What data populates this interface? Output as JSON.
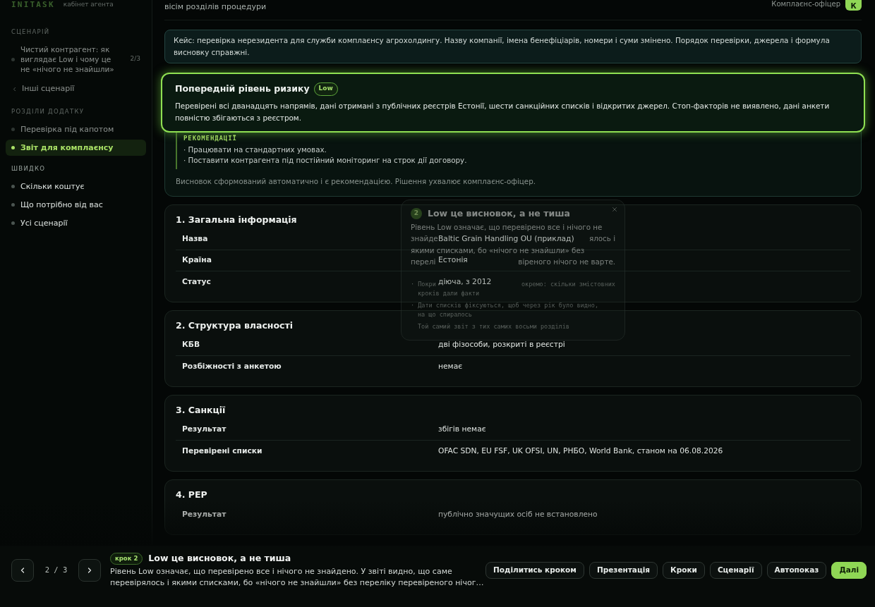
{
  "sidebar": {
    "brand": {
      "name": "INITASK",
      "note": "кабінет агента",
      "dimmed": true
    },
    "groups": [
      {
        "label": "СЦЕНАРІЙ",
        "dimmed": true,
        "items": [
          {
            "kind": "scenario",
            "label": "Чистий контрагент: як виглядає Low і чому це не «нічого не знайшли»",
            "count": "2/3",
            "selected": false,
            "dimmed": true
          },
          {
            "kind": "back",
            "label": "Інші сценарії",
            "selected": false,
            "dimmed": true
          }
        ]
      },
      {
        "label": "РОЗДІЛИ ДОДАТКУ",
        "dimmed": true,
        "items": [
          {
            "kind": "link",
            "label": "Перевірка під капотом",
            "selected": false,
            "dimmed": true
          },
          {
            "kind": "link",
            "label": "Звіт для комплаєнсу",
            "selected": true,
            "dimmed": false
          }
        ]
      },
      {
        "label": "ШВИДКО",
        "dimmed": false,
        "items": [
          {
            "kind": "link",
            "label": "Скільки коштує",
            "selected": false,
            "dimmed": false
          },
          {
            "kind": "link",
            "label": "Що потрібно від вас",
            "selected": false,
            "dimmed": false
          },
          {
            "kind": "link",
            "label": "Усі сценарії",
            "selected": false,
            "dimmed": false
          }
        ]
      }
    ]
  },
  "header": {
    "subtitle": "вісім розділів процедури",
    "role": "Комплаєнс-офіцер",
    "avatar": "К"
  },
  "case_note": "Кейс: перевірка нерезидента для служби комплаєнсу агрохолдингу. Назву компанії, імена бенефіціарів, номери і суми змінено. Порядок перевірки, джерела і формула висновку справжні.",
  "risk": {
    "title": "Попередній рівень ризику",
    "badge": "Low",
    "highlighted": true,
    "summary": "Перевірені всі дванадцять напрямів, дані отримані з публічних реєстрів Естонії, шести санкційних списків і відкритих джерел. Стоп-факторів не виявлено, дані анкети повністю збігаються з реєстром.",
    "recommendations": {
      "label": "РЕКОМЕНДАЦІЇ",
      "items": [
        "· Працювати на стандартних умовах.",
        "· Поставити контрагента під постійний моніторинг на строк дії договору."
      ]
    },
    "footnote": "Висновок сформований автоматично і є рекомендацією. Рішення ухвалює комплаєнс-офіцер."
  },
  "sections": [
    {
      "title": "1. Загальна інформація",
      "rows": [
        {
          "label": "Назва",
          "value": "Baltic Grain Handling OU (приклад)"
        },
        {
          "label": "Країна",
          "value": "Естонія"
        },
        {
          "label": "Статус",
          "value": "діюча, з 2012"
        }
      ]
    },
    {
      "title": "2. Структура власності",
      "rows": [
        {
          "label": "КБВ",
          "value": "дві фізособи, розкриті в реєстрі"
        },
        {
          "label": "Розбіжності з анкетою",
          "value": "немає"
        }
      ]
    },
    {
      "title": "3. Санкції",
      "rows": [
        {
          "label": "Результат",
          "value": "збігів немає"
        },
        {
          "label": "Перевірені списки",
          "value": "OFAC SDN, EU FSF, UK OFSI, UN, РНБО, World Bank, станом на 06.08.2026"
        }
      ]
    },
    {
      "title": "4. PEP",
      "rows": [
        {
          "label": "Результат",
          "value": "публічно значущих осіб не встановлено"
        }
      ]
    }
  ],
  "tour_tooltip": {
    "fading": true,
    "number": "2",
    "title": "Low це висновок, а не тиша",
    "paragraphs": [
      {
        "kind": "body",
        "lines": [
          [
            "Рівень Low означає, що перевірено все і нічого не"
          ],
          [
            "знайде",
            "ялось і"
          ],
          [
            "якими списками, бо «нічого не знайшли» без"
          ],
          [
            "перелі",
            "віреного нічого не варте."
          ]
        ]
      },
      {
        "kind": "point",
        "lines": [
          [
            "· Покри",
            "окремо: скільки змістовних"
          ],
          [
            "кроків дали факти"
          ]
        ]
      },
      {
        "kind": "point",
        "lines": [
          [
            "· Дати списків фіксуються, щоб через рік було видно,"
          ],
          [
            "на що спиралось"
          ]
        ]
      },
      {
        "kind": "note",
        "lines": [
          [
            "Той самий звіт з тих самих восьми розділів"
          ]
        ]
      }
    ]
  },
  "tour_bar": {
    "counter": "2 / 3",
    "step": "крок 2",
    "title": "Low це висновок, а не тиша",
    "text": "Рівень Low означає, що перевірено все і нічого не знайдено. У звіті видно, що саме перевірялось і якими списками, бо «нічого не знайшли» без переліку перевіреного нічог…",
    "buttons": [
      {
        "label": "Поділитись кроком",
        "kind": "secondary"
      },
      {
        "label": "Презентація",
        "kind": "secondary"
      },
      {
        "label": "Кроки",
        "kind": "secondary"
      },
      {
        "label": "Сценарії",
        "kind": "secondary"
      },
      {
        "label": "Автопоказ",
        "kind": "secondary"
      },
      {
        "label": "Далі",
        "kind": "primary"
      }
    ]
  }
}
